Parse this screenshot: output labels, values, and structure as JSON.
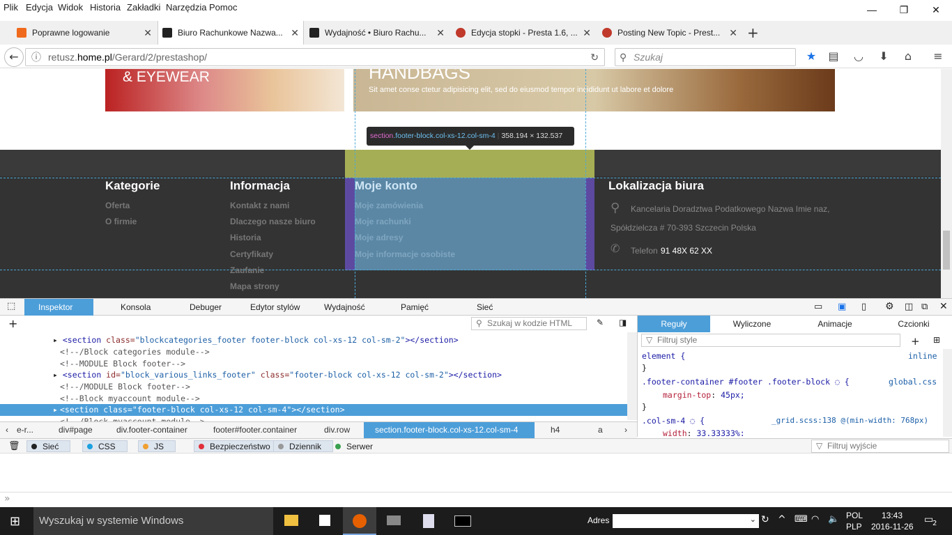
{
  "menu": [
    "Plik",
    "Edycja",
    "Widok",
    "Historia",
    "Zakładki",
    "Narzędzia",
    "Pomoc"
  ],
  "window": {
    "minimize": "—",
    "maximize": "❐",
    "close": "✕"
  },
  "tabs": [
    {
      "title": "Poprawne logowanie",
      "color": "#f06a1d"
    },
    {
      "title": "Biuro Rachunkowe Nazwa...",
      "color": "#222222"
    },
    {
      "title": "Wydajność • Biuro Rachu...",
      "color": "#222222"
    },
    {
      "title": "Edycja stopki - Presta 1.6, ...",
      "color": "#c0392b"
    },
    {
      "title": "Posting New Topic - Prest...",
      "color": "#c0392b"
    }
  ],
  "new_tab": "+",
  "url": {
    "prefix": "retusz.",
    "host": "home.pl",
    "path": "/Gerard/2/prestashop/"
  },
  "search": {
    "placeholder": "Szukaj"
  },
  "page": {
    "banner_left_text": "& EYEWEAR",
    "banner_right_title": "HANDBAGS",
    "banner_right_text": "Sit amet conse ctetur adipisicing elit, sed do eiusmod tempor incididunt ut labore et dolore",
    "tooltip": {
      "tag": "section",
      "cls": ".footer-block.col-xs-12.col-sm-4",
      "size": "358.194 × 132.537"
    },
    "footer": {
      "categories": {
        "title": "Kategorie",
        "items": [
          "Oferta",
          "O firmie"
        ]
      },
      "info": {
        "title": "Informacja",
        "items": [
          "Kontakt z nami",
          "Dlaczego nasze biuro",
          "Historia",
          "Certyfikaty",
          "Zaufanie",
          "Mapa strony"
        ]
      },
      "account": {
        "title": "Moje konto",
        "items": [
          "Moje zamówienia",
          "Moje rachunki",
          "Moje adresy",
          "Moje informacje osobiste"
        ]
      },
      "location": {
        "title": "Lokalizacja biura",
        "address1": "Kancelaria Doradztwa Podatkowego Nazwa Imie naz,",
        "address2": "Spółdzielcza # 70-393 Szczecin Polska",
        "phone_label": "Telefon",
        "phone": "91 48X 62 XX"
      }
    }
  },
  "devtools": {
    "tabs": [
      "Inspektor",
      "Konsola",
      "Debuger",
      "Edytor stylów",
      "Wydajność",
      "Pamięć",
      "Sieć"
    ],
    "search_placeholder": "Szukaj w kodzie HTML",
    "markup": [
      {
        "open": "<section ",
        "a": "class=",
        "v": "\"blockcategories_footer footer-block col-xs-12 col-sm-2\"",
        "close": "></section>"
      },
      {
        "comment": "<!--/Block categories module-->"
      },
      {
        "comment": "<!--MODULE Block footer-->"
      },
      {
        "open": "<section ",
        "a": "id=",
        "v": "\"block_various_links_footer\"",
        "a2": " class=",
        "v2": "\"footer-block col-xs-12 col-sm-2\"",
        "close": "></section>"
      },
      {
        "comment": "<!--/MODULE Block footer-->"
      },
      {
        "comment": "<!--Block myaccount module-->"
      },
      {
        "selected": "<section class=\"footer-block col-xs-12 col-sm-4\"></section>"
      },
      {
        "comment": "<!--/Block myaccount module-->"
      }
    ],
    "breadcrumbs": [
      "e-r...",
      "div#page",
      "div.footer-container",
      "footer#footer.container",
      "div.row",
      "section.footer-block.col-xs-12.col-sm-4",
      "h4",
      "a"
    ],
    "rule_tabs": [
      "Reguły",
      "Wyliczone",
      "Animacje",
      "Czcionki"
    ],
    "filter_styles": "Filtruj style",
    "rules": [
      {
        "sel": "element {",
        "src": "inline"
      },
      {
        "sel": "}",
        "src": ""
      },
      {
        "sel": ".footer-container #footer .footer-block ◌ {",
        "src": "global.css"
      },
      {
        "prop": "margin-top",
        "val": "45px;"
      },
      {
        "sel": "}",
        "src": ""
      },
      {
        "sel": ".col-sm-4 ◌ {",
        "src": "_grid.scss:138 @(min-width: 768px)"
      },
      {
        "prop": "width",
        "val": "33.33333%;"
      }
    ],
    "console_filters": [
      {
        "label": "Sieć",
        "color": "#222222"
      },
      {
        "label": "CSS",
        "color": "#1da1e0"
      },
      {
        "label": "JS",
        "color": "#f0a030"
      },
      {
        "label": "Bezpieczeństwo",
        "color": "#e0303a"
      },
      {
        "label": "Dziennik",
        "color": "#999999"
      },
      {
        "label": "Serwer",
        "color": "#3aa050"
      }
    ],
    "filter_output": "Filtruj wyjście",
    "prompt": "»"
  },
  "taskbar": {
    "search": "Wyszukaj w systemie Windows",
    "address_label": "Adres",
    "lang": "POL",
    "lang2": "PLP",
    "time": "13:43",
    "date": "2016-11-26",
    "notifications": "2"
  }
}
